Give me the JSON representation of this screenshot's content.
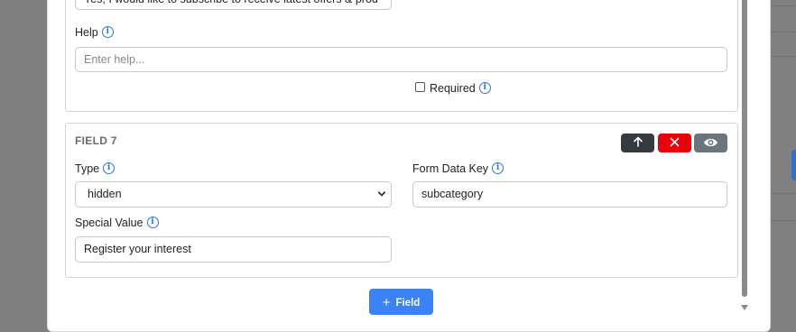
{
  "field6": {
    "choice_value": "Yes, I would like to subscribe to receive latest offers & prod",
    "help_label": "Help",
    "help_placeholder": "Enter help...",
    "required_label": "Required"
  },
  "field7": {
    "title": "FIELD 7",
    "type_label": "Type",
    "type_value": "hidden",
    "form_data_key_label": "Form Data Key",
    "form_data_key_value": "subcategory",
    "special_value_label": "Special Value",
    "special_value_value": "Register your interest",
    "buttons": {
      "up": "↑",
      "remove": "✕",
      "preview": "eye"
    }
  },
  "add_field_button": {
    "icon": "+",
    "label": "Field"
  },
  "icons": {
    "info": "i"
  },
  "colors": {
    "primary": "#3b82f6",
    "danger": "#e8000b",
    "dark": "#343a40",
    "secondary": "#6c757d"
  }
}
